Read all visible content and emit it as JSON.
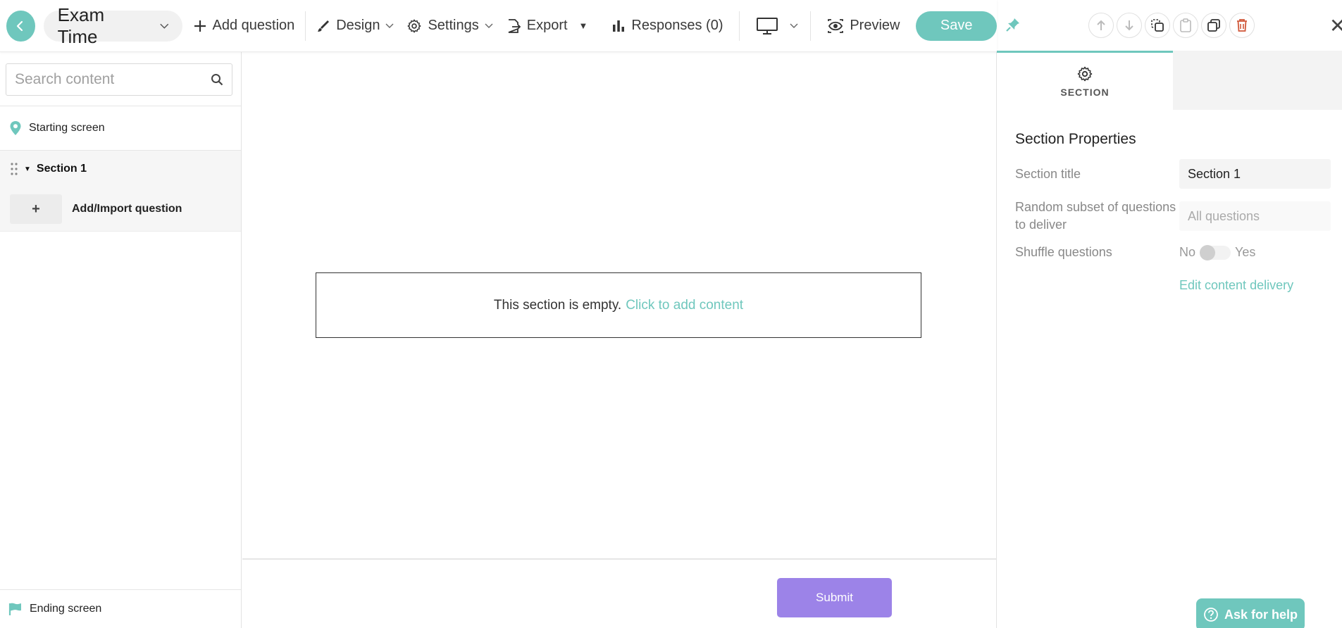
{
  "header": {
    "title": "Exam Time",
    "add_question": "Add question",
    "design": "Design",
    "settings": "Settings",
    "export": "Export",
    "responses": "Responses (0)",
    "preview": "Preview",
    "save": "Save"
  },
  "sidebar": {
    "search_placeholder": "Search content",
    "starting_screen": "Starting screen",
    "section_title": "Section 1",
    "add_import": "Add/Import question",
    "ending_screen": "Ending screen"
  },
  "canvas": {
    "empty_text": "This section is empty.",
    "empty_link": "Click to add content",
    "submit": "Submit"
  },
  "panel": {
    "tab_label": "SECTION",
    "heading": "Section Properties",
    "section_title_label": "Section title",
    "section_title_value": "Section 1",
    "random_subset_label": "Random subset of questions to deliver",
    "random_subset_placeholder": "All questions",
    "shuffle_label": "Shuffle questions",
    "shuffle_no": "No",
    "shuffle_yes": "Yes",
    "shuffle_enabled": false,
    "edit_delivery": "Edit content delivery",
    "help": "Ask for help"
  },
  "colors": {
    "accent": "#6fc7bd",
    "submit": "#9c83e8",
    "delete": "#d0583a"
  }
}
